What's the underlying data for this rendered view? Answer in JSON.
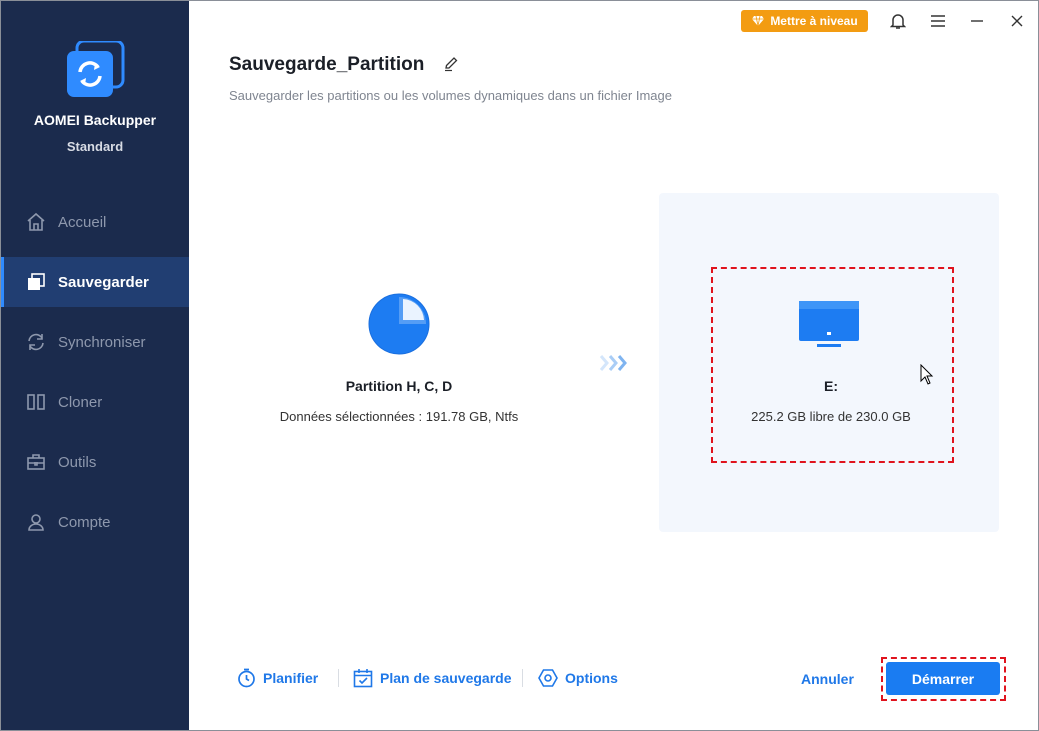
{
  "app": {
    "name": "AOMEI Backupper",
    "edition": "Standard"
  },
  "sidebar": {
    "items": [
      {
        "label": "Accueil",
        "icon": "home-icon",
        "active": false
      },
      {
        "label": "Sauvegarder",
        "icon": "backup-icon",
        "active": true
      },
      {
        "label": "Synchroniser",
        "icon": "sync-icon",
        "active": false
      },
      {
        "label": "Cloner",
        "icon": "clone-icon",
        "active": false
      },
      {
        "label": "Outils",
        "icon": "tools-icon",
        "active": false
      },
      {
        "label": "Compte",
        "icon": "account-icon",
        "active": false
      }
    ]
  },
  "titlebar": {
    "upgrade_label": "Mettre à niveau"
  },
  "header": {
    "title": "Sauvegarde_Partition",
    "subtitle": "Sauvegarder les partitions ou les volumes dynamiques dans un fichier Image"
  },
  "source": {
    "name": "Partition H, C, D",
    "info": "Données sélectionnées : 191.78 GB, Ntfs"
  },
  "destination": {
    "name": "E:",
    "info": "225.2 GB libre de 230.0 GB"
  },
  "footer": {
    "schedule_label": "Planifier",
    "plan_label": "Plan de sauvegarde",
    "options_label": "Options",
    "cancel_label": "Annuler",
    "start_label": "Démarrer"
  },
  "colors": {
    "sidebar_bg": "#1b2b4d",
    "sidebar_active": "#213e72",
    "accent": "#1a7cf2",
    "upgrade": "#f39c12",
    "highlight": "#e0131d"
  }
}
